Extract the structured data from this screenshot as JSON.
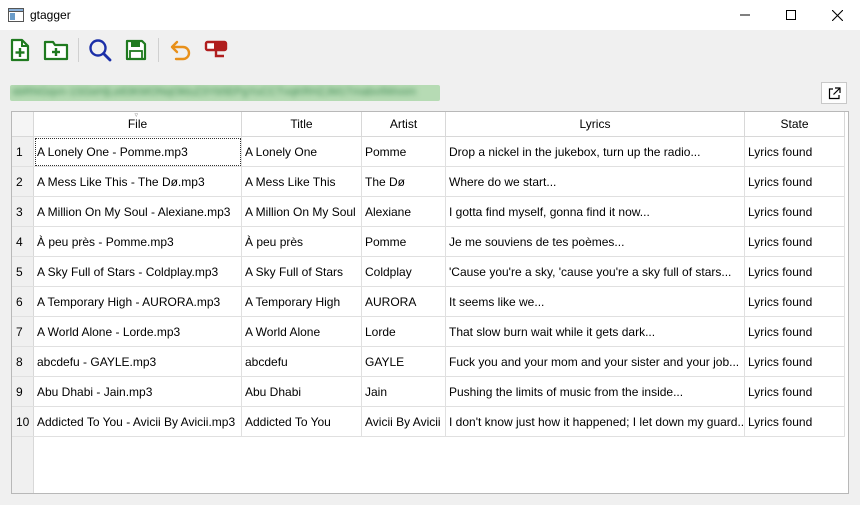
{
  "window": {
    "title": "gtagger"
  },
  "toolbar": {
    "buttons": [
      {
        "name": "add-file-button",
        "icon": "add-file-icon",
        "color": "#1f7a1f"
      },
      {
        "name": "add-folder-button",
        "icon": "add-folder-icon",
        "color": "#1f7a1f"
      },
      {
        "name": "search-lyrics-button",
        "icon": "search-icon",
        "color": "#1b2fa8"
      },
      {
        "name": "save-button",
        "icon": "save-icon",
        "color": "#1f7a1f"
      },
      {
        "name": "undo-button",
        "icon": "undo-icon",
        "color": "#e8901a"
      },
      {
        "name": "remove-tags-button",
        "icon": "eraser-icon",
        "color": "#b01e1e"
      }
    ]
  },
  "path": {
    "value": "sbRNGqvn-1SGeHjLe83KMONqOktuZ3Yb5EPgYuCCTvqKRHZJM1TmabvIlWvom"
  },
  "table": {
    "columns": [
      "File",
      "Title",
      "Artist",
      "Lyrics",
      "State"
    ],
    "rows": [
      {
        "num": "1",
        "file": "A Lonely One - Pomme.mp3",
        "title": "A Lonely One",
        "artist": "Pomme",
        "lyrics": "Drop a nickel in the jukebox, turn up the radio...",
        "state": "Lyrics found"
      },
      {
        "num": "2",
        "file": "A Mess Like This - The Dø.mp3",
        "title": "A Mess Like This",
        "artist": "The Dø",
        "lyrics": "Where do we start...",
        "state": "Lyrics found"
      },
      {
        "num": "3",
        "file": "A Million On My Soul - Alexiane.mp3",
        "title": "A Million On My Soul",
        "artist": "Alexiane",
        "lyrics": "I gotta find myself, gonna find it now...",
        "state": "Lyrics found"
      },
      {
        "num": "4",
        "file": "À peu près - Pomme.mp3",
        "title": "À peu près",
        "artist": "Pomme",
        "lyrics": "Je me souviens de tes poèmes...",
        "state": "Lyrics found"
      },
      {
        "num": "5",
        "file": "A Sky Full of Stars - Coldplay.mp3",
        "title": "A Sky Full of Stars",
        "artist": "Coldplay",
        "lyrics": "'Cause you're a sky, 'cause you're a sky full of stars...",
        "state": "Lyrics found"
      },
      {
        "num": "6",
        "file": "A Temporary High - AURORA.mp3",
        "title": "A Temporary High",
        "artist": "AURORA",
        "lyrics": "It seems like we...",
        "state": "Lyrics found"
      },
      {
        "num": "7",
        "file": "A World Alone - Lorde.mp3",
        "title": "A World Alone",
        "artist": "Lorde",
        "lyrics": "That slow burn wait while it gets dark...",
        "state": "Lyrics found"
      },
      {
        "num": "8",
        "file": "abcdefu - GAYLE.mp3",
        "title": "abcdefu",
        "artist": "GAYLE",
        "lyrics": "Fuck you and your mom and your sister and your job...",
        "state": "Lyrics found"
      },
      {
        "num": "9",
        "file": "Abu Dhabi - Jain.mp3",
        "title": "Abu Dhabi",
        "artist": "Jain",
        "lyrics": "Pushing the limits of music from the inside...",
        "state": "Lyrics found"
      },
      {
        "num": "10",
        "file": "Addicted To You - Avicii By Avicii.mp3",
        "title": "Addicted To You",
        "artist": "Avicii By Avicii",
        "lyrics": "I don't know just how it happened; I let down my guard...",
        "state": "Lyrics found"
      }
    ]
  }
}
